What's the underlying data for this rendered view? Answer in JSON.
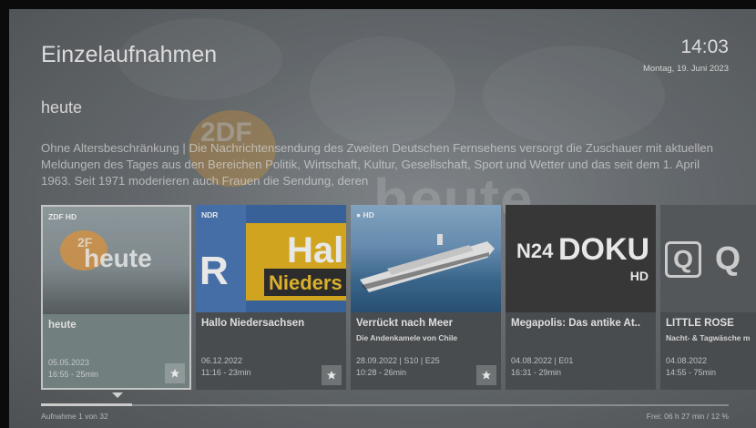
{
  "header": {
    "title": "Einzelaufnahmen",
    "time": "14:03",
    "date": "Montag, 19. Juni 2023"
  },
  "program": {
    "title": "heute",
    "description": "Ohne Altersbeschränkung  |  Die Nachrichtensendung des Zweiten Deutschen Fernsehens versorgt die Zuschauer mit aktuellen Meldungen des Tages aus den Bereichen Politik, Wirtschaft, Kultur, Gesellschaft, Sport und Wetter und das seit dem 1. April 1963. Seit 1971 moderieren auch Frauen die Sendung, deren",
    "background_logo_text": "heute"
  },
  "recordings": [
    {
      "channel": "ZDF HD",
      "thumb_text": "heute",
      "title": "heute",
      "subtitle": "",
      "date": "05.05.2023",
      "time": "16:55 - 25min",
      "favorite": true,
      "focused": true
    },
    {
      "channel": "NDR",
      "thumb_text": "Hal",
      "thumb_text2": "Nieders",
      "thumb_text3": "R",
      "title": "Hallo Niedersachsen",
      "subtitle": "",
      "date": "06.12.2022",
      "time": "11:16 - 23min",
      "favorite": true,
      "focused": false
    },
    {
      "channel": "HD",
      "title": "Verrückt nach Meer",
      "subtitle": "Die Andenkamele von Chile",
      "date": "28.09.2022 | S10 | E25",
      "time": "10:28 - 26min",
      "favorite": true,
      "focused": false
    },
    {
      "channel": "",
      "thumb_text": "N24",
      "thumb_text2": "DOKU",
      "thumb_text3": "HD",
      "title": "Megapolis: Das antike At..",
      "subtitle": "",
      "date": "04.08.2022 | E01",
      "time": "16:31 - 29min",
      "favorite": false,
      "focused": false
    },
    {
      "channel": "",
      "thumb_text": "Q",
      "title": "LITTLE ROSE",
      "subtitle": "Nacht- & Tagwäsche m",
      "date": "04.08.2022",
      "time": "14:55 - 75min",
      "favorite": false,
      "focused": false
    }
  ],
  "footer": {
    "count": "Aufnahme 1 von 32",
    "free": "Frei: 06 h 27 min / 12 %",
    "position_fraction": 0.03
  },
  "colors": {
    "zdf_orange": "#f39200",
    "focus_border": "#d8d8d8",
    "background": "#6d7276"
  },
  "icons": [
    "star-icon",
    "zdf-logo",
    "ndr-logo",
    "das-erste-hd-logo",
    "n24-doku-logo",
    "qvc-logo"
  ]
}
